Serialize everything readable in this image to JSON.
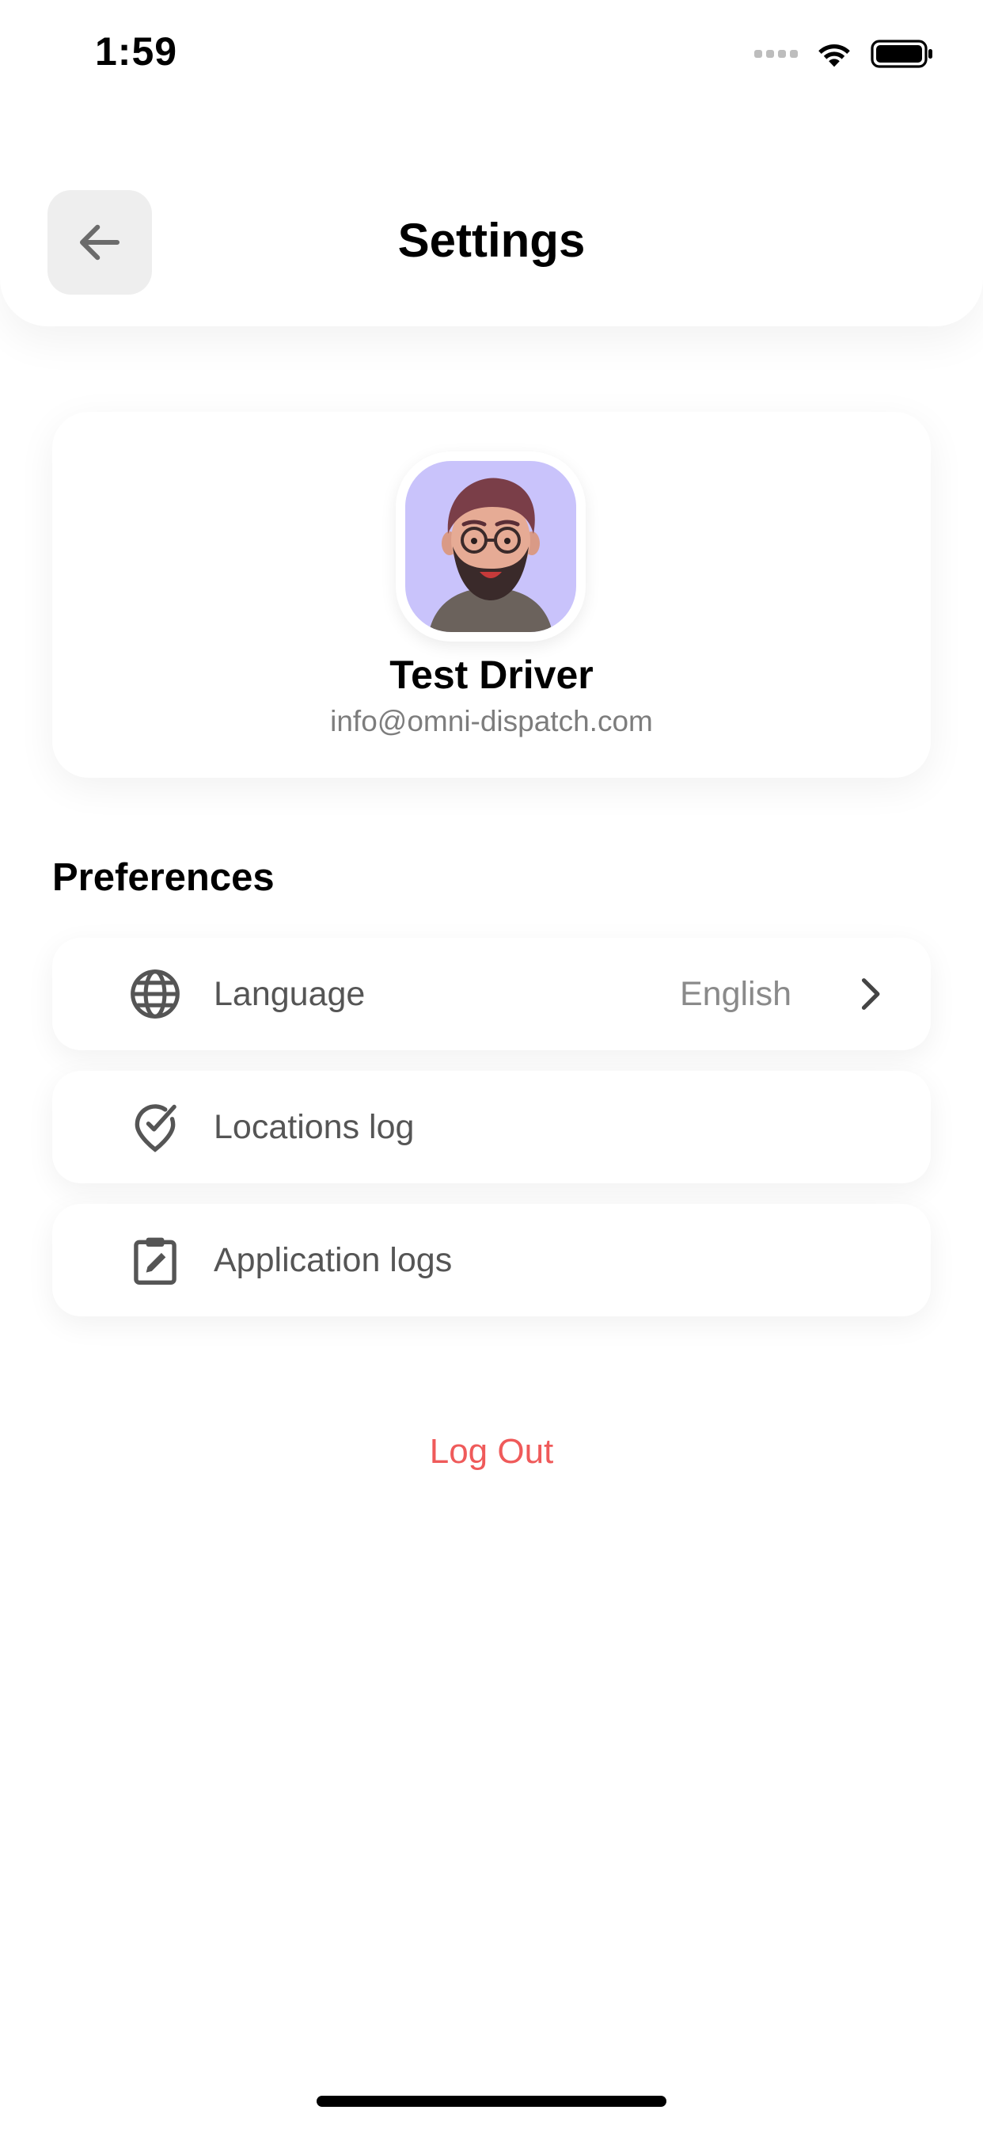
{
  "status_bar": {
    "time": "1:59",
    "icons": [
      "signal-icon",
      "wifi-icon",
      "battery-icon"
    ]
  },
  "header": {
    "title": "Settings",
    "back_icon": "arrow-left-icon"
  },
  "profile": {
    "name": "Test Driver",
    "email": "info@omni-dispatch.com",
    "avatar_background": "#c9c3fb"
  },
  "preferences": {
    "title": "Preferences",
    "items": [
      {
        "label": "Language",
        "value": "English",
        "icon": "globe-icon",
        "chevron": "chevron-right-icon"
      },
      {
        "label": "Locations log",
        "icon": "location-check-icon"
      },
      {
        "label": "Application logs",
        "icon": "clipboard-edit-icon"
      }
    ]
  },
  "logout": {
    "label": "Log Out",
    "color": "#ef5a5a"
  }
}
